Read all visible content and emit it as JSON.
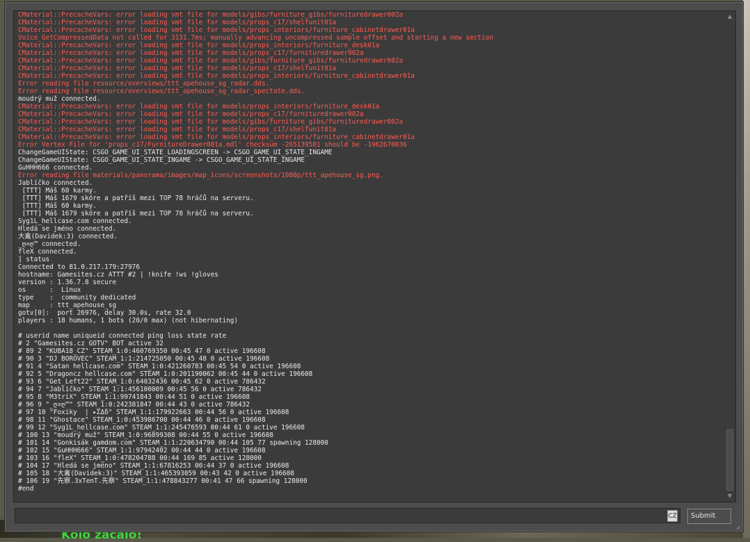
{
  "background": {
    "round_message": "Kolo začalo!"
  },
  "console": {
    "lines": [
      {
        "t": "CMaterial::PrecacheVars: error loading vmt file for models/gibs/furniture_gibs/furnituredrawer002a",
        "err": true
      },
      {
        "t": "CMaterial::PrecacheVars: error loading vmt file for models/props_c17/shelfunit01a",
        "err": true
      },
      {
        "t": "CMaterial::PrecacheVars: error loading vmt file for models/props_interiors/furniture_cabinetdrawer01a",
        "err": true
      },
      {
        "t": "Voice_GetCompressedData not called for 3131.7ms; manually advancing uncompressed sample offset and starting a new section",
        "err": true
      },
      {
        "t": "CMaterial::PrecacheVars: error loading vmt file for models/props_interiors/furniture_desk01a",
        "err": true
      },
      {
        "t": "CMaterial::PrecacheVars: error loading vmt file for models/props_c17/furnituredrawer002a",
        "err": true
      },
      {
        "t": "CMaterial::PrecacheVars: error loading vmt file for models/gibs/furniture_gibs/furnituredrawer002a",
        "err": true
      },
      {
        "t": "CMaterial::PrecacheVars: error loading vmt file for models/props_c17/shelfunit01a",
        "err": true
      },
      {
        "t": "CMaterial::PrecacheVars: error loading vmt file for models/props_interiors/furniture_cabinetdrawer01a",
        "err": true
      },
      {
        "t": "Error reading file resource/overviews/ttt_apehouse_sg_radar.dds.",
        "err": true
      },
      {
        "t": "Error reading file resource/overviews/ttt_apehouse_sg_radar_spectate.dds.",
        "err": true
      },
      {
        "t": "moudrý muž connected.",
        "err": false
      },
      {
        "t": "CMaterial::PrecacheVars: error loading vmt file for models/props_interiors/furniture_desk01a",
        "err": true
      },
      {
        "t": "CMaterial::PrecacheVars: error loading vmt file for models/props_c17/furnituredrawer002a",
        "err": true
      },
      {
        "t": "CMaterial::PrecacheVars: error loading vmt file for models/gibs/furniture_gibs/furnituredrawer002a",
        "err": true
      },
      {
        "t": "CMaterial::PrecacheVars: error loading vmt file for models/props_c17/shelfunit01a",
        "err": true
      },
      {
        "t": "CMaterial::PrecacheVars: error loading vmt file for models/props_interiors/furniture_cabinetdrawer01a",
        "err": true
      },
      {
        "t": "Error Vertex File for 'props_c17/FurnitureDrawer001a.mdl' checksum -265139501 should be -1962670036",
        "err": true
      },
      {
        "t": "ChangeGameUIState: CSGO_GAME_UI_STATE_LOADINGSCREEN -> CSGO_GAME_UI_STATE_INGAME",
        "err": false
      },
      {
        "t": "ChangeGameUIState: CSGO_GAME_UI_STATE_INGAME -> CSGO_GAME_UI_STATE_INGAME",
        "err": false
      },
      {
        "t": "GuHHH666 connected.",
        "err": false
      },
      {
        "t": "Error reading file materials/panorama/images/map_icons/screenshots/1080p/ttt_apehouse_sg.png.",
        "err": true
      },
      {
        "t": "Jablíčko connected.",
        "err": false
      },
      {
        "t": " [TTT] Máš 60 karmy.",
        "err": false
      },
      {
        "t": " [TTT] Máš 1679 skóre a patříš mezi TOP 78 hráčů na serveru.",
        "err": false
      },
      {
        "t": " [TTT] Máš 60 karmy.",
        "err": false
      },
      {
        "t": " [TTT] Máš 1679 skóre a patříš mezi TOP 78 hráčů na serveru.",
        "err": false
      },
      {
        "t": "Syg1L_hellcase.com connected.",
        "err": false
      },
      {
        "t": "Hledá se jméno connected.",
        "err": false
      },
      {
        "t": "大禽(Davidek:3) connected.",
        "err": false
      },
      {
        "t": "_ღ¤ღ™ connected.",
        "err": false
      },
      {
        "t": "fleX connected.",
        "err": false
      },
      {
        "t": "] status",
        "err": false
      },
      {
        "t": "Connected to 81.0.217.179:27976",
        "err": false
      },
      {
        "t": "hostname: Gamesites.cz ATTT #2 | !knife !ws !gloves",
        "err": false
      },
      {
        "t": "version : 1.36.7.8 secure",
        "err": false
      },
      {
        "t": "os      :  Linux",
        "err": false
      },
      {
        "t": "type    :  community dedicated",
        "err": false
      },
      {
        "t": "map     : ttt_apehouse_sg",
        "err": false
      },
      {
        "t": "gotv[0]:  port 26976, delay 30.0s, rate 32.0",
        "err": false
      },
      {
        "t": "players : 18 humans, 1 bots (20/0 max) (not hibernating)",
        "err": false
      },
      {
        "t": "",
        "err": false
      },
      {
        "t": "# userid name uniqueid connected ping loss state rate",
        "err": false
      },
      {
        "t": "# 2 \"Gamesites.cz GOTV\" BOT active 32",
        "err": false
      },
      {
        "t": "# 89 2 \"KUBA18_CZ\" STEAM_1:0:460769350 00:45 47 0 active 196608",
        "err": false
      },
      {
        "t": "# 90 3 \"DJ BOROVEC\" STEAM_1:1:214725050 00:45 48 0 active 196608",
        "err": false
      },
      {
        "t": "# 91 4 \"Satan hellcase.com\" STEAM_1:0:421260783 00:45 54 0 active 196608",
        "err": false
      },
      {
        "t": "# 92 5 \"Dragoncz hellcase.com\" STEAM_1:0:201190062 00:45 44 0 active 196608",
        "err": false
      },
      {
        "t": "# 93 6 \"Get_Left22\" STEAM_1:0:64032436 00:45 62 0 active 786432",
        "err": false
      },
      {
        "t": "# 94 7 \"Jablíčko\" STEAM_1:1:456100009 00:45 56 0 active 786432",
        "err": false
      },
      {
        "t": "# 95 8 \"M3triX\" STEAM_1:1:99741843 00:44 51 0 active 196608",
        "err": false
      },
      {
        "t": "# 96 9 \"_ღ¤ღ™\" STEAM_1:0:242381847 00:44 43 0 active 786432",
        "err": false
      },
      {
        "t": "# 97 10 \"Foxiky  | ▸ΣΔδ\" STEAM_1:1:179922663 00:44 56 0 active 196608",
        "err": false
      },
      {
        "t": "# 98 11 \"Ghostace\" STEAM_1:0:453986700 00:44 46 0 active 196608",
        "err": false
      },
      {
        "t": "# 99 12 \"Syg1L_hellcase.com\" STEAM_1:1:245476593 00:44 61 0 active 196608",
        "err": false
      },
      {
        "t": "# 100 13 \"moudrý muž\" STEAM_1:0:96899308 00:44 55 0 active 196608",
        "err": false
      },
      {
        "t": "# 101 14 \"Gonkisák gamdom.com\" STEAM_1:1:220634790 00:44 105 77 spawning 128000",
        "err": false
      },
      {
        "t": "# 102 15 \"GuHHH666\" STEAM_1:1:97942402 00:44 44 0 active 196608",
        "err": false
      },
      {
        "t": "# 103 16 \"fleX\" STEAM_1:0:478204788 00:44 169 85 active 128000",
        "err": false
      },
      {
        "t": "# 104 17 \"Hledá se jméno\" STEAM_1:1:67816253 00:44 37 0 active 196608",
        "err": false
      },
      {
        "t": "# 105 18 \"大禽(Davidek:3)\" STEAM_1:1:465393059 00:43 42 0 active 196608",
        "err": false
      },
      {
        "t": "# 106 19 \"先察.3xTenT.先察\" STEAM_1:1:478843277 00:41 47 66 spawning 128000",
        "err": false
      },
      {
        "t": "#end",
        "err": false
      }
    ],
    "input_value": "",
    "language_indicator": "CZ",
    "submit_label": "Submit"
  }
}
